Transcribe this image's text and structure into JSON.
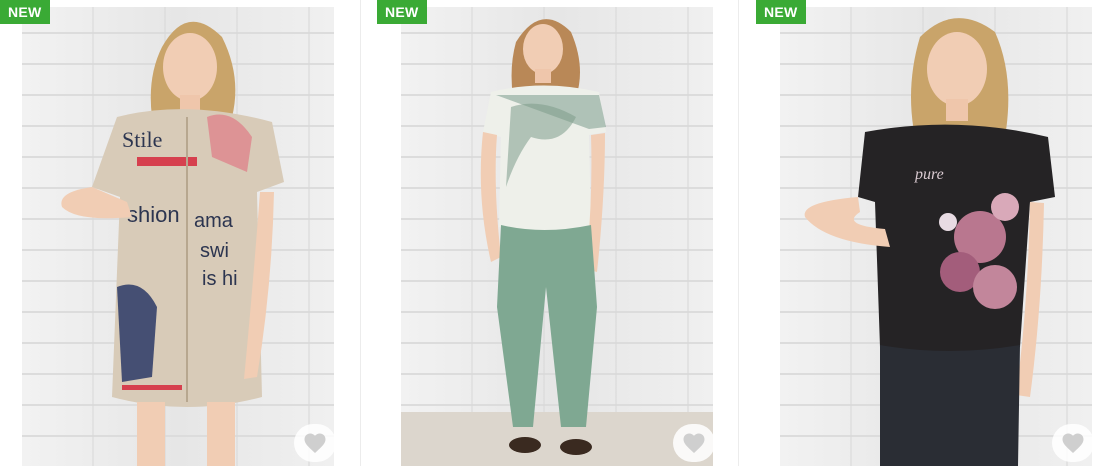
{
  "products": [
    {
      "badge": "NEW",
      "image_desc": "woman-beige-print-dress",
      "favorite_icon": "heart-icon"
    },
    {
      "badge": "NEW",
      "image_desc": "woman-floral-top-green-pants",
      "favorite_icon": "heart-icon"
    },
    {
      "badge": "NEW",
      "image_desc": "woman-black-floral-tshirt",
      "favorite_icon": "heart-icon"
    }
  ],
  "colors": {
    "badge_bg": "#3aaa35",
    "badge_text": "#ffffff",
    "heart": "#cfcfcf"
  }
}
